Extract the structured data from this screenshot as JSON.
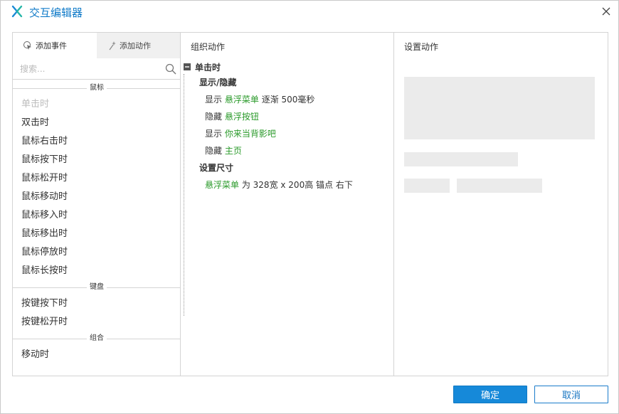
{
  "window": {
    "title": "交互编辑器"
  },
  "left_panel": {
    "tabs": [
      {
        "label": "添加事件",
        "icon": "cursor-click-icon",
        "active": true
      },
      {
        "label": "添加动作",
        "icon": "sparkle-icon",
        "active": false
      }
    ],
    "search": {
      "placeholder": "搜索..."
    },
    "groups": [
      {
        "label": "鼠标",
        "items": [
          "单击时",
          "双击时",
          "鼠标右击时",
          "鼠标按下时",
          "鼠标松开时",
          "鼠标移动时",
          "鼠标移入时",
          "鼠标移出时",
          "鼠标停放时",
          "鼠标长按时"
        ]
      },
      {
        "label": "键盘",
        "items": [
          "按键按下时",
          "按键松开时"
        ]
      },
      {
        "label": "组合",
        "items": [
          "移动时"
        ]
      }
    ]
  },
  "middle_panel": {
    "header": "组织动作",
    "event": "单击时",
    "action_groups": [
      {
        "label": "显示/隐藏",
        "lines": [
          {
            "verb": "显示",
            "target": "悬浮菜单",
            "detail": "逐渐 500毫秒"
          },
          {
            "verb": "隐藏",
            "target": "悬浮按钮",
            "detail": ""
          },
          {
            "verb": "显示",
            "target": "你来当背影吧",
            "detail": ""
          },
          {
            "verb": "隐藏",
            "target": "主页",
            "detail": ""
          }
        ]
      },
      {
        "label": "设置尺寸",
        "lines": [
          {
            "verb": "",
            "target": "悬浮菜单",
            "detail": "为 328宽 x 200高 锚点 右下"
          }
        ]
      }
    ]
  },
  "right_panel": {
    "header": "设置动作"
  },
  "footer": {
    "ok_label": "确定",
    "cancel_label": "取消"
  },
  "colors": {
    "accent": "#1689d9",
    "title": "#0f7ac8",
    "target_green": "#2a9a2a",
    "disabled": "#bdbdbd"
  }
}
